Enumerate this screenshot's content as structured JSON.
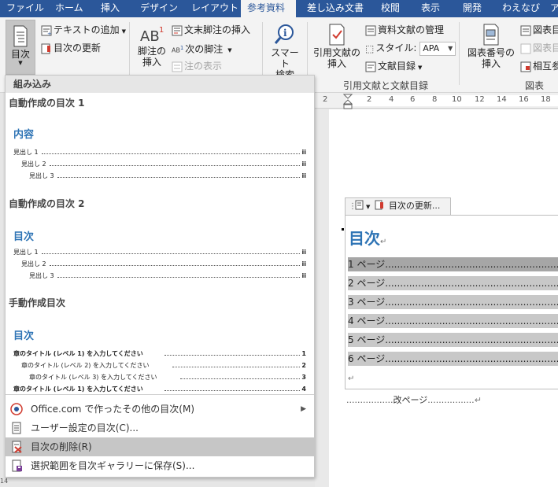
{
  "tabs": [
    {
      "label": "ファイル"
    },
    {
      "label": "ホーム"
    },
    {
      "label": "挿入"
    },
    {
      "label": "デザイン"
    },
    {
      "label": "レイアウト"
    },
    {
      "label": "参考資料"
    },
    {
      "label": "差し込み文書"
    },
    {
      "label": "校閲"
    },
    {
      "label": "表示"
    },
    {
      "label": "開発"
    },
    {
      "label": "わえなび"
    },
    {
      "label": "ア"
    }
  ],
  "ribbon": {
    "toc_button": "目次",
    "add_text": "テキストの追加",
    "update_toc": "目次の更新",
    "insert_footnote_line1": "脚注の",
    "insert_footnote_line2": "挿入",
    "insert_endnote": "文末脚注の挿入",
    "next_footnote": "次の脚注",
    "show_notes": "注の表示",
    "smart_lookup_line1": "スマート",
    "smart_lookup_line2": "検索",
    "insert_citation_line1": "引用文献の",
    "insert_citation_line2": "挿入",
    "manage_sources": "資料文献の管理",
    "style_label": "スタイル:",
    "style_value": "APA",
    "bibliography": "文献目録",
    "citations_group": "引用文献と文献目録",
    "insert_caption_line1": "図表番号の",
    "insert_caption_line2": "挿入",
    "insert_table_of_figures": "図表目",
    "update_table": "図表目",
    "cross_reference": "相互参",
    "captions_group": "図表"
  },
  "ruler": {
    "labels": [
      "2",
      "2",
      "4",
      "6",
      "8",
      "10",
      "12",
      "14",
      "16",
      "18"
    ]
  },
  "document": {
    "cc_update": "目次の更新...",
    "toc_title": "目次",
    "pilcrow": "↵",
    "toc_lines": [
      {
        "label": "1 ページ"
      },
      {
        "label": "2 ページ"
      },
      {
        "label": "3 ページ"
      },
      {
        "label": "4 ページ"
      },
      {
        "label": "5 ページ"
      },
      {
        "label": "6 ページ"
      }
    ],
    "end_mark": "↵",
    "page_break": "改ページ",
    "page_break_mark": "↵"
  },
  "dropdown": {
    "header": "組み込み",
    "gallery": [
      {
        "title": "自動作成の目次 1",
        "heading": "内容",
        "lines": [
          {
            "label": "見出し 1",
            "page": "ii"
          },
          {
            "label": "見出し 2",
            "page": "ii"
          },
          {
            "label": "見出し 3",
            "page": "ii"
          }
        ]
      },
      {
        "title": "自動作成の目次 2",
        "heading": "目次",
        "lines": [
          {
            "label": "見出し 1",
            "page": "ii"
          },
          {
            "label": "見出し 2",
            "page": "ii"
          },
          {
            "label": "見出し 3",
            "page": "ii"
          }
        ]
      },
      {
        "title": "手動作成目次",
        "heading": "目次",
        "lines": [
          {
            "label": "章のタイトル (レベル 1) を入力してください",
            "page": "1"
          },
          {
            "label": "章のタイトル (レベル 2) を入力してください",
            "page": "2"
          },
          {
            "label": "章のタイトル (レベル 3) を入力してください",
            "page": "3"
          },
          {
            "label": "章のタイトル (レベル 1) を入力してください",
            "page": "4"
          }
        ]
      }
    ],
    "items": [
      {
        "label": "Office.com で作ったその他の目次(M)"
      },
      {
        "label": "ユーザー設定の目次(C)..."
      },
      {
        "label": "目次の削除(R)"
      },
      {
        "label": "選択範囲を目次ギャラリーに保存(S)..."
      }
    ]
  },
  "colors": {
    "accent": "#2b579a",
    "heading": "#2e74b5",
    "highlight": "#c6c6c6"
  }
}
